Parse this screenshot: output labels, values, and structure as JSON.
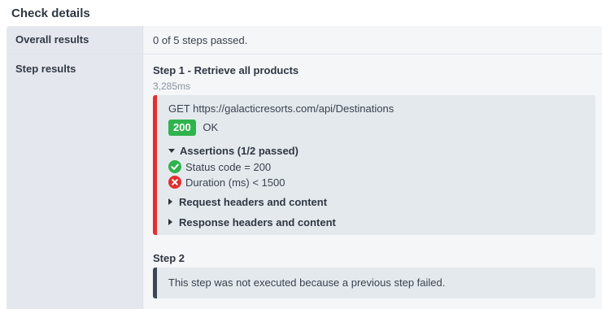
{
  "header": {
    "title": "Check details"
  },
  "overall": {
    "label": "Overall results",
    "value": "0 of 5 steps passed."
  },
  "step_results": {
    "label": "Step results",
    "step1": {
      "title": "Step 1 - Retrieve all products",
      "duration": "3,285ms",
      "request": "GET https://galacticresorts.com/api/Destinations",
      "status_code": "200",
      "status_text": "OK",
      "assertions_header": "Assertions (1/2 passed)",
      "assertions": [
        {
          "text": "Status code = 200",
          "passed": true,
          "icon": "check-circle-icon"
        },
        {
          "text": "Duration (ms) < 1500",
          "passed": false,
          "icon": "x-circle-icon"
        }
      ],
      "request_headers": "Request headers and content",
      "response_headers": "Response headers and content"
    },
    "step2": {
      "title": "Step 2",
      "message": "This step was not executed because a previous step failed."
    }
  },
  "colors": {
    "pass": "#2fb34c",
    "fail": "#e0302f",
    "neutral": "#3d4652"
  }
}
